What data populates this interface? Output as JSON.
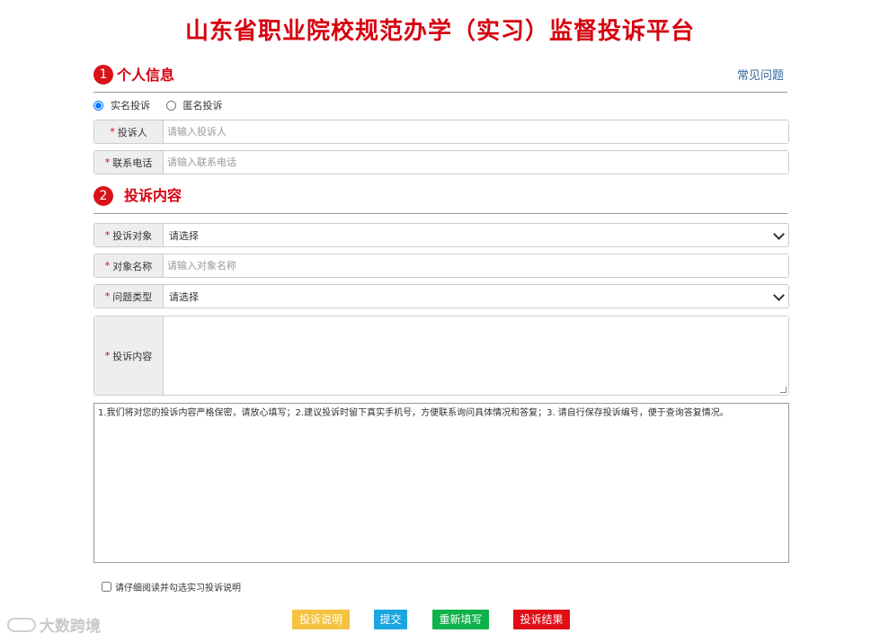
{
  "page": {
    "title": "山东省职业院校规范办学（实习）监督投诉平台"
  },
  "section1": {
    "number": "1",
    "title": "个人信息",
    "faq_link": "常见问题"
  },
  "complaint_type": {
    "options": [
      "实名投诉",
      "匿名投诉"
    ],
    "selected": "实名投诉"
  },
  "personal": {
    "complainant_label": "投诉人",
    "complainant_placeholder": "请输入投诉人",
    "phone_label": "联系电话",
    "phone_placeholder": "请输入联系电话"
  },
  "section2": {
    "number": "2",
    "title": "投诉内容"
  },
  "content": {
    "target_label": "投诉对象",
    "target_value": "请选择",
    "target_name_label": "对象名称",
    "target_name_placeholder": "请输入对象名称",
    "issue_type_label": "问题类型",
    "issue_type_value": "请选择",
    "complaint_content_label": "投诉内容",
    "required_mark": "*"
  },
  "notice": {
    "text": "1.我们将对您的投诉内容严格保密，请放心填写；2.建议投诉时留下真实手机号，方便联系询问具体情况和答复；3. 请自行保存投诉编号，便于查询答复情况。"
  },
  "agreement": {
    "label": "请仔细阅读并勾选实习投诉说明",
    "checked": false
  },
  "buttons": {
    "explain": "投诉说明",
    "submit": "提交",
    "reset": "重新填写",
    "result": "投诉结果"
  },
  "watermark": {
    "text": "大数跨境"
  },
  "colors": {
    "title_red": "#d6000f",
    "btn_yellow": "#f5c342",
    "btn_blue": "#1ba6e0",
    "btn_green": "#0fb24a",
    "btn_red": "#e00d17"
  }
}
